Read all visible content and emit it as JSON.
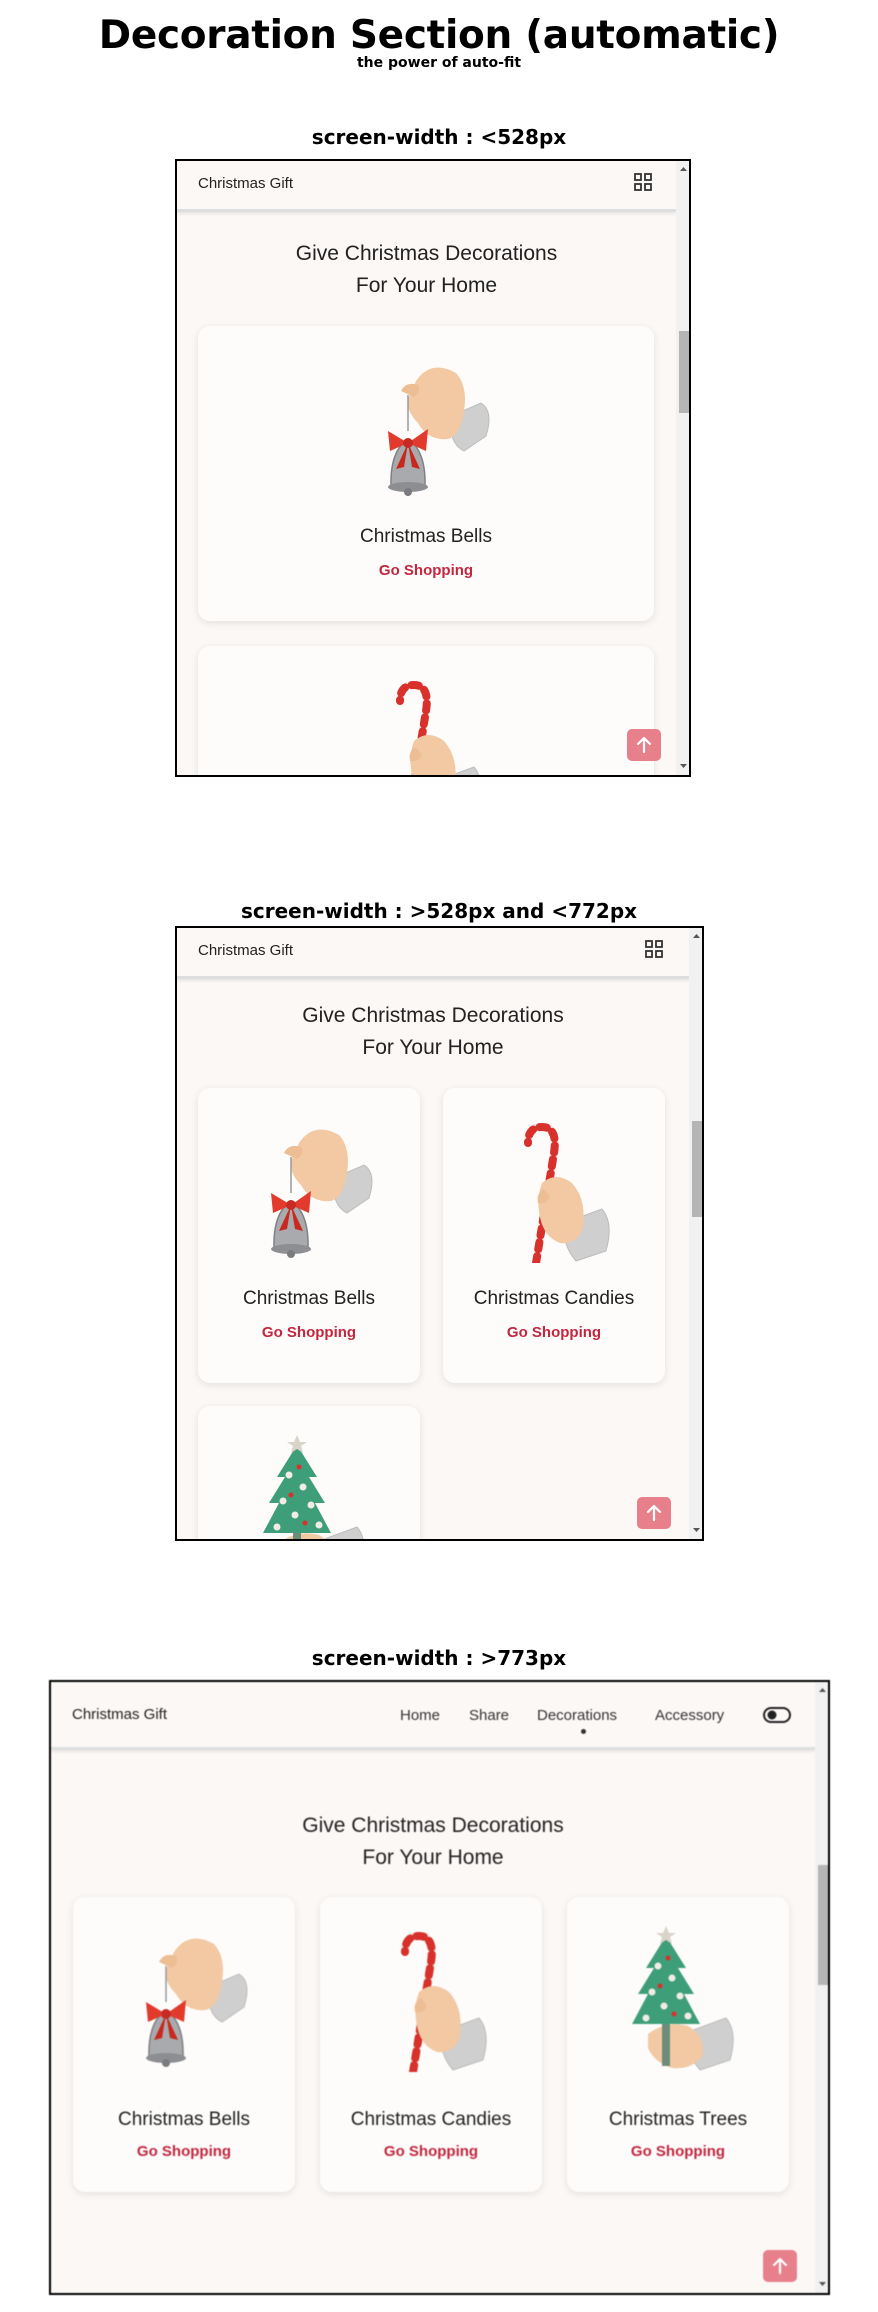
{
  "title": "Decoration Section (automatic)",
  "subtitle": "the power of auto-fit",
  "sections": [
    {
      "label": "screen-width : <528px",
      "logo": "Christmas Gift",
      "heading_line1": "Give Christmas Decorations",
      "heading_line2": "For Your Home",
      "cards": [
        {
          "title": "Christmas Bells",
          "link": "Go Shopping",
          "image": "bell-in-hand"
        },
        {
          "title": "",
          "link": "",
          "image": "candy-cane-in-hand"
        }
      ],
      "icons": [
        "grid-menu-icon",
        "arrow-up-icon"
      ]
    },
    {
      "label": "screen-width : >528px and <772px",
      "logo": "Christmas Gift",
      "heading_line1": "Give Christmas Decorations",
      "heading_line2": "For Your Home",
      "cards": [
        {
          "title": "Christmas Bells",
          "link": "Go Shopping",
          "image": "bell-in-hand"
        },
        {
          "title": "Christmas Candies",
          "link": "Go Shopping",
          "image": "candy-cane-in-hand"
        },
        {
          "title": "",
          "link": "",
          "image": "tree-in-hand"
        }
      ],
      "icons": [
        "grid-menu-icon",
        "arrow-up-icon"
      ]
    },
    {
      "label": "screen-width : >773px",
      "logo": "Christmas Gift",
      "nav": [
        "Home",
        "Share",
        "Decorations",
        "Accessory"
      ],
      "active_nav": "Decorations",
      "heading_line1": "Give Christmas Decorations",
      "heading_line2": "For Your Home",
      "cards": [
        {
          "title": "Christmas Bells",
          "link": "Go Shopping",
          "image": "bell-in-hand"
        },
        {
          "title": "Christmas Candies",
          "link": "Go Shopping",
          "image": "candy-cane-in-hand"
        },
        {
          "title": "Christmas Trees",
          "link": "Go Shopping",
          "image": "tree-in-hand"
        }
      ],
      "icons": [
        "theme-toggle-icon",
        "arrow-up-icon"
      ]
    }
  ],
  "colors": {
    "accent": "#c2273f",
    "page_bg": "#fcf8f6",
    "button": "#e8808c"
  }
}
